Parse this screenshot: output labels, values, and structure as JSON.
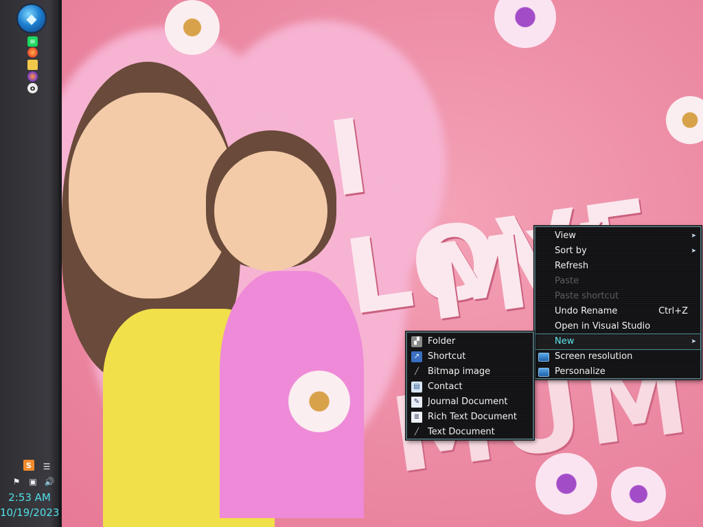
{
  "wallpaper": {
    "text_line1": "I LOVE",
    "text_line2": "MY",
    "text_line3": "MUM"
  },
  "taskbar": {
    "start_icon": "dolphin-orb-icon",
    "quick_launch": [
      {
        "name": "spotify-icon"
      },
      {
        "name": "firefox-icon"
      },
      {
        "name": "file-explorer-icon"
      },
      {
        "name": "firefox-developer-icon"
      },
      {
        "name": "obs-icon"
      }
    ],
    "tray": {
      "sublime_glyph": "S",
      "clock_time": "2:53 AM",
      "clock_date": "10/19/2023"
    }
  },
  "context_menu": {
    "items": [
      {
        "label": "View",
        "has_submenu": true,
        "enabled": true
      },
      {
        "label": "Sort by",
        "has_submenu": true,
        "enabled": true
      },
      {
        "label": "Refresh",
        "enabled": true
      },
      {
        "label": "Paste",
        "enabled": false
      },
      {
        "label": "Paste shortcut",
        "enabled": false
      },
      {
        "label": "Undo Rename",
        "shortcut": "Ctrl+Z",
        "enabled": true
      },
      {
        "label": "Open in Visual Studio",
        "enabled": true
      },
      {
        "label": "New",
        "has_submenu": true,
        "enabled": true,
        "active": true
      },
      {
        "label": "Screen resolution",
        "icon": "monitor-icon",
        "enabled": true
      },
      {
        "label": "Personalize",
        "icon": "personalize-icon",
        "enabled": true
      }
    ]
  },
  "new_submenu": {
    "items": [
      {
        "label": "Folder",
        "icon": "folder-icon"
      },
      {
        "label": "Shortcut",
        "icon": "shortcut-icon"
      },
      {
        "label": "Bitmap image",
        "icon": "bitmap-icon"
      },
      {
        "label": "Contact",
        "icon": "contact-icon"
      },
      {
        "label": "Journal Document",
        "icon": "journal-icon"
      },
      {
        "label": "Rich Text Document",
        "icon": "rich-text-icon"
      },
      {
        "label": "Text Document",
        "icon": "text-document-icon"
      }
    ]
  },
  "colors": {
    "accent_cyan": "#5fe6ef",
    "menu_bg": "#121214",
    "menu_border": "#4d6a70",
    "disabled_text": "#5e5e62"
  }
}
